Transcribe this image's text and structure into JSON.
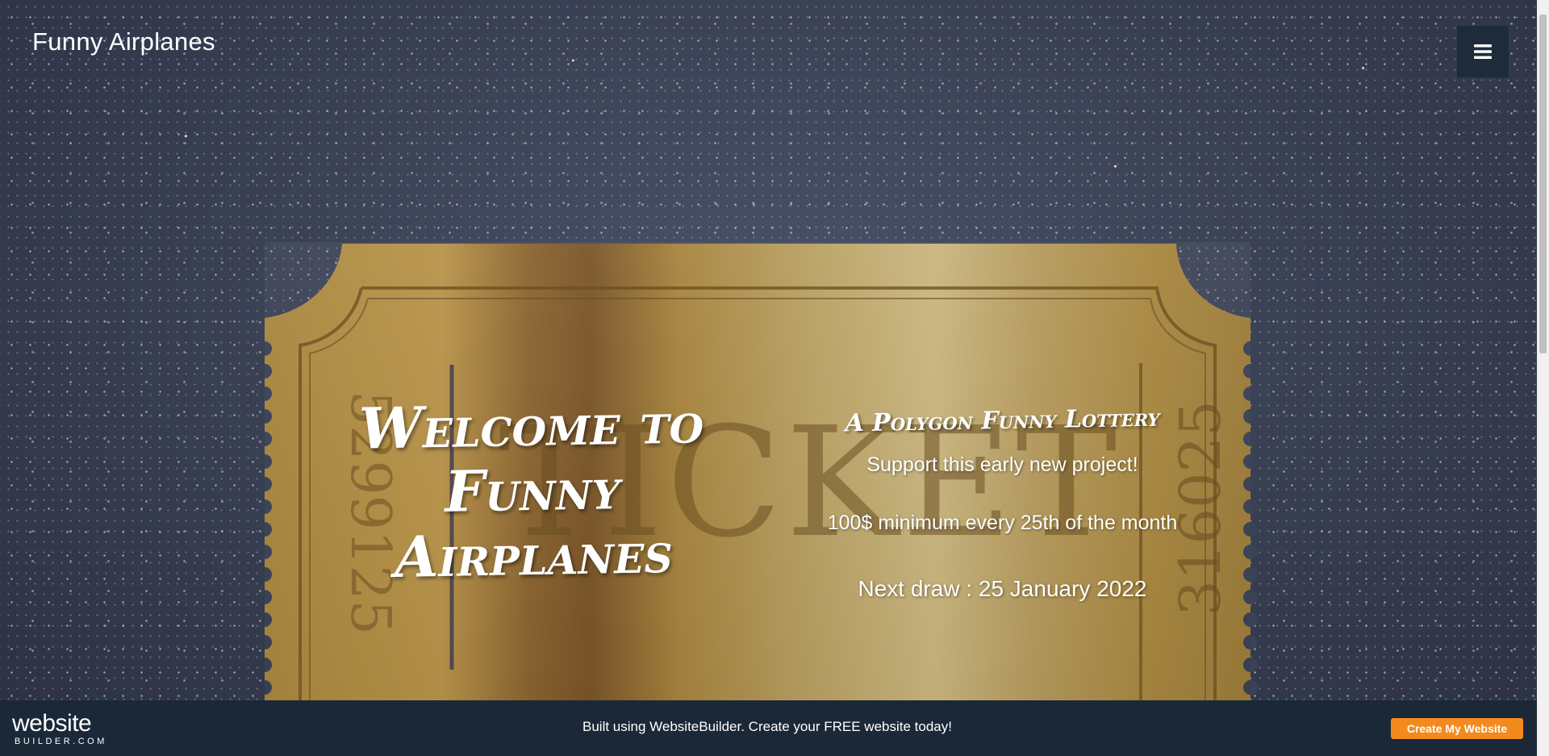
{
  "header": {
    "site_title": "Funny Airplanes",
    "menu_icon": "hamburger-menu-icon"
  },
  "hero": {
    "heading": "Welcome to Funny Airplanes",
    "tagline": "A Polygon Funny Lottery",
    "support": "Support this early new project!",
    "minimum": "100$ minimum every 25th of the month",
    "next_draw": "Next draw : 25 January 2022"
  },
  "ticket_image": {
    "word": "TICKET",
    "left_number": "5299125",
    "right_number": "316025",
    "colors": {
      "gold_light": "#c9b27a",
      "gold_mid": "#a8893f",
      "gold_dark": "#7a5a28",
      "outline": "#6b4f22"
    }
  },
  "footer": {
    "logo_main": "website",
    "logo_sub": "BUILDER.COM",
    "promo_text": "Built using WebsiteBuilder. Create your FREE website today!",
    "cta_label": "Create My Website"
  },
  "colors": {
    "nav_button_bg": "#1e2b3a",
    "footer_bg": "#1b2838",
    "cta_bg": "#f38a1e"
  }
}
